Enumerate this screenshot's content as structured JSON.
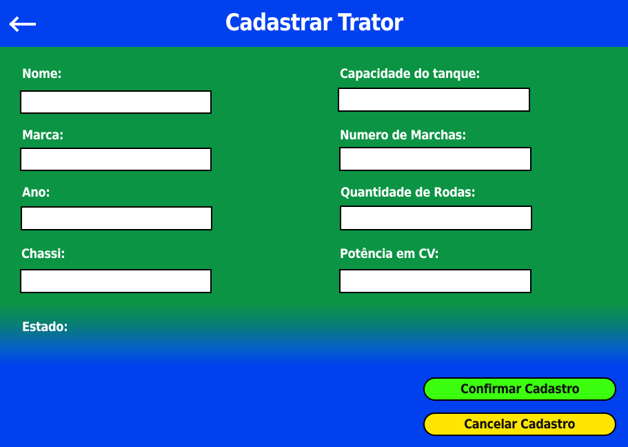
{
  "header": {
    "title": "Cadastrar Trator",
    "back_icon": "arrow-left-icon"
  },
  "form": {
    "nome_label": "Nome:",
    "marca_label": "Marca:",
    "ano_label": "Ano:",
    "chassi_label": "Chassi:",
    "capacidade_label": "Capacidade do tanque:",
    "marchas_label": "Numero de Marchas:",
    "rodas_label": "Quantidade de Rodas:",
    "potencia_label": "Potência em CV:",
    "estado_label": "Estado:"
  },
  "actions": {
    "confirm_label": "Confirmar Cadastro",
    "cancel_label": "Cancelar Cadastro"
  },
  "colors": {
    "header_blue": "#0140ef",
    "form_green": "#0b9443",
    "confirm_green": "#3cff10",
    "cancel_yellow": "#ffe600"
  }
}
